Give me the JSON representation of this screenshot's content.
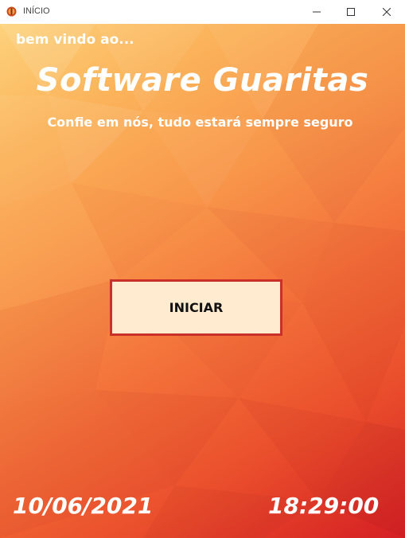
{
  "window": {
    "title": "INÍCIO",
    "icon": "shield-icon",
    "controls": {
      "minimize": "minimize-icon",
      "maximize": "maximize-icon",
      "close": "close-icon"
    }
  },
  "content": {
    "welcome": "bem vindo ao...",
    "title": "Software Guaritas",
    "tagline": "Confie em nós, tudo estará sempre seguro",
    "start_button": "INICIAR",
    "date": "10/06/2021",
    "time": "18:29:00"
  },
  "colors": {
    "background_top": "#fdd27c",
    "background_bottom": "#d51f23",
    "button_fill": "#feebd0",
    "button_border": "#c9302a",
    "text": "#ffffff"
  }
}
